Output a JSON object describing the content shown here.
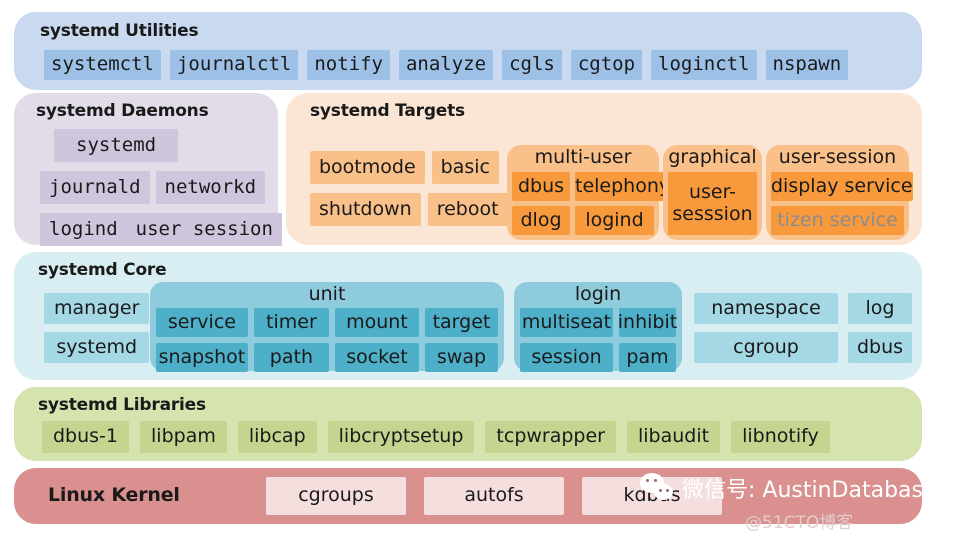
{
  "utilities": {
    "title": "systemd Utilities",
    "items": [
      "systemctl",
      "journalctl",
      "notify",
      "analyze",
      "cgls",
      "cgtop",
      "loginctl",
      "nspawn"
    ],
    "panel_color": "#c8d9f0",
    "chip_color": "#9dc0e6"
  },
  "daemons": {
    "title": "systemd Daemons",
    "rows": [
      [
        "systemd"
      ],
      [
        "journald",
        "networkd"
      ],
      [
        "logind",
        "user session"
      ]
    ],
    "panel_color": "#e2dce9",
    "chip_color": "#cfc6dd"
  },
  "targets": {
    "title": "systemd Targets",
    "plain_rows": [
      [
        "bootmode",
        "basic"
      ],
      [
        "shutdown",
        "reboot"
      ]
    ],
    "groups": [
      {
        "label": "multi-user",
        "rows": [
          [
            {
              "label": "dbus",
              "muted": false
            },
            {
              "label": "telephony",
              "muted": false
            }
          ],
          [
            {
              "label": "dlog",
              "muted": false
            },
            {
              "label": "logind",
              "muted": false
            }
          ]
        ]
      },
      {
        "label": "graphical",
        "rows": [
          [
            {
              "label": "user-sesssion",
              "muted": false
            }
          ]
        ]
      },
      {
        "label": "user-session",
        "rows": [
          [
            {
              "label": "display service",
              "muted": false
            }
          ],
          [
            {
              "label": "tizen service",
              "muted": true
            }
          ]
        ]
      }
    ],
    "panel_color": "#fbe6d6",
    "chip_color": "#fac08a",
    "sub_color": "#f89a3c",
    "muted_text_color": "#8c8c8c"
  },
  "core": {
    "title": "systemd Core",
    "left_column": [
      "manager",
      "systemd"
    ],
    "groups": [
      {
        "label": "unit",
        "rows": [
          [
            "service",
            "timer",
            "mount",
            "target"
          ],
          [
            "snapshot",
            "path",
            "socket",
            "swap"
          ]
        ]
      },
      {
        "label": "login",
        "rows": [
          [
            "multiseat",
            "inhibit"
          ],
          [
            "session",
            "pam"
          ]
        ]
      }
    ],
    "right_rows": [
      [
        "namespace",
        "log"
      ],
      [
        "cgroup",
        "dbus"
      ]
    ],
    "panel_color": "#d8eef3",
    "chip_color": "#a5d8e5",
    "group_color": "#8ecbdc",
    "sub_color": "#4dafc8"
  },
  "libraries": {
    "title": "systemd Libraries",
    "items": [
      "dbus-1",
      "libpam",
      "libcap",
      "libcryptsetup",
      "tcpwrapper",
      "libaudit",
      "libnotify"
    ],
    "panel_color": "#d5e3ae",
    "chip_color": "#c4d58f"
  },
  "kernel": {
    "title": "Linux Kernel",
    "items": [
      "cgroups",
      "autofs",
      "kdbus"
    ],
    "panel_color": "#d9908f",
    "chip_color": "#f5dede"
  },
  "watermark": {
    "text": "微信号: AustinDatabases",
    "subtext": "@51CTO博客",
    "logo_icon": "wechat-icon"
  }
}
